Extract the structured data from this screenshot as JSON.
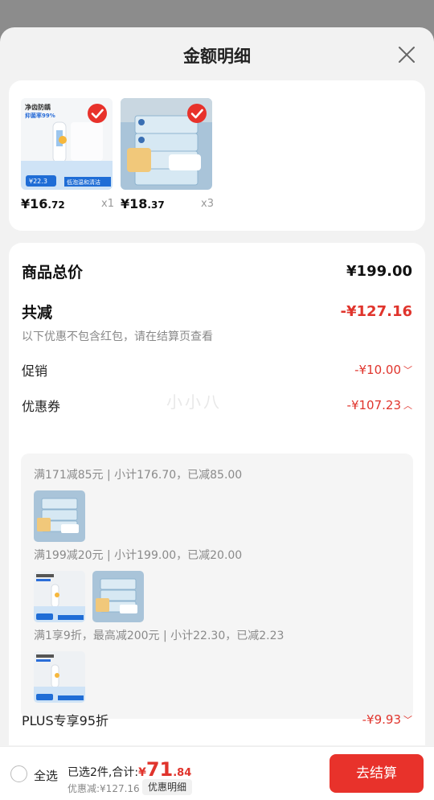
{
  "sheet": {
    "title": "金额明细"
  },
  "products": [
    {
      "price_int": "¥16",
      "price_cents": ".72",
      "qty": "x1",
      "image": "hand-soap-bottle",
      "checked": true
    },
    {
      "price_int": "¥18",
      "price_cents": ".37",
      "qty": "x3",
      "image": "tissue-packs",
      "checked": true
    }
  ],
  "thumb_text": {
    "p1_head1": "净齿防龋",
    "p1_head2": "抑菌率99%",
    "p1_price": "¥22.3",
    "p1_banner": "低泡温和清洁"
  },
  "summary": {
    "total_label": "商品总价",
    "total_value": "¥199.00",
    "reduce_label": "共减",
    "reduce_value": "-¥127.16",
    "note": "以下优惠不包含红包，请在结算页查看",
    "promo_label": "促销",
    "promo_value": "-¥10.00",
    "coupon_label": "优惠券",
    "coupon_value": "-¥107.23",
    "plus_label": "PLUS专享95折",
    "plus_value": "-¥9.93"
  },
  "coupons": [
    {
      "text": "满171减85元 | 小计176.70，已减85.00"
    },
    {
      "text": "满199减20元 | 小计199.00，已减20.00"
    },
    {
      "text": "满1享9折，最高减200元 | 小计22.30，已减2.23"
    }
  ],
  "watermark": "小小八",
  "bottom": {
    "select_all": "全选",
    "selected_text": "已选2件,合计:",
    "total_yen": "¥",
    "total_int": "71",
    "total_cents": ".84",
    "discount_text": "优惠减:¥127.16",
    "detail_pill": "优惠明细",
    "checkout": "去结算"
  },
  "colors": {
    "accent": "#e8322b",
    "price_red": "#e0342c"
  }
}
